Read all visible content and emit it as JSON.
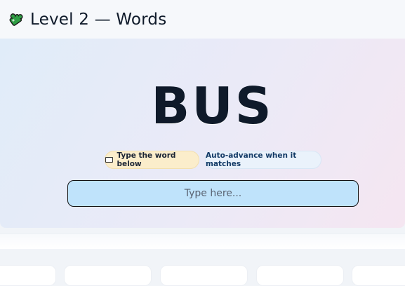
{
  "header": {
    "title": "Level 2 — Words",
    "icon": "puzzle-piece-icon",
    "icon_color": "#2f9e44"
  },
  "main": {
    "word": "BUS",
    "hint_label": "Type the word below",
    "hint_icon": "keyboard-icon",
    "auto_label": "Auto-advance when it matches",
    "input": {
      "value": "",
      "placeholder": "Type here..."
    }
  },
  "colors": {
    "input_bg": "#bfe3fb",
    "hint_bg": "#fbedcb",
    "auto_bg": "#eaf2fb"
  }
}
